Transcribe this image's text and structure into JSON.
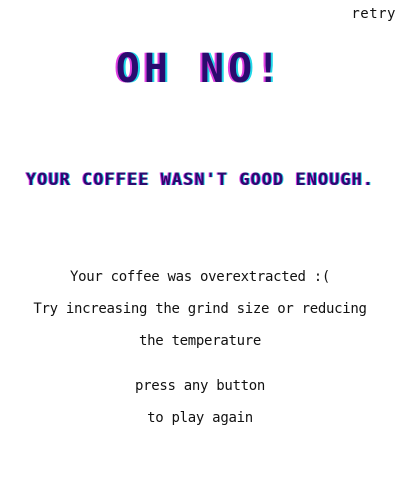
{
  "header": {
    "retry_label": "retry"
  },
  "result": {
    "headline": "OH NO!",
    "subheadline": "YOUR COFFEE WASN'T GOOD ENOUGH.",
    "diagnosis": "Your coffee was overextracted :(",
    "tip_line_1": "Try increasing the grind size or reducing",
    "tip_line_2": "the temperature",
    "prompt_line_1": "press any button",
    "prompt_line_2": "to play again"
  },
  "colors": {
    "title": "#2a0b6e",
    "glitch_magenta": "#e040e0",
    "glitch_cyan": "#20d8e8",
    "text": "#111111",
    "background": "#ffffff"
  }
}
